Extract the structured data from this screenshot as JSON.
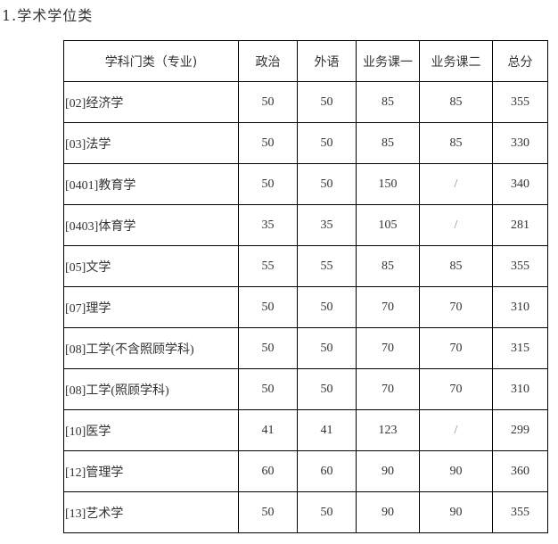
{
  "heading": "1.学术学位类",
  "table": {
    "headers": [
      "学科门类（专业)",
      "政治",
      "外语",
      "业务课一",
      "业务课二",
      "总分"
    ],
    "rows": [
      [
        "[02]经济学",
        "50",
        "50",
        "85",
        "85",
        "355"
      ],
      [
        "[03]法学",
        "50",
        "50",
        "85",
        "85",
        "330"
      ],
      [
        "[0401]教育学",
        "50",
        "50",
        "150",
        "/",
        "340"
      ],
      [
        "[0403]体育学",
        "35",
        "35",
        "105",
        "/",
        "281"
      ],
      [
        "[05]文学",
        "55",
        "55",
        "85",
        "85",
        "355"
      ],
      [
        "[07]理学",
        "50",
        "50",
        "70",
        "70",
        "310"
      ],
      [
        "[08]工学(不含照顾学科)",
        "50",
        "50",
        "70",
        "70",
        "315"
      ],
      [
        "[08]工学(照顾学科)",
        "50",
        "50",
        "70",
        "70",
        "310"
      ],
      [
        "[10]医学",
        "41",
        "41",
        "123",
        "/",
        "299"
      ],
      [
        "[12]管理学",
        "60",
        "60",
        "90",
        "90",
        "360"
      ],
      [
        "[13]艺术学",
        "50",
        "50",
        "90",
        "90",
        "355"
      ]
    ]
  }
}
